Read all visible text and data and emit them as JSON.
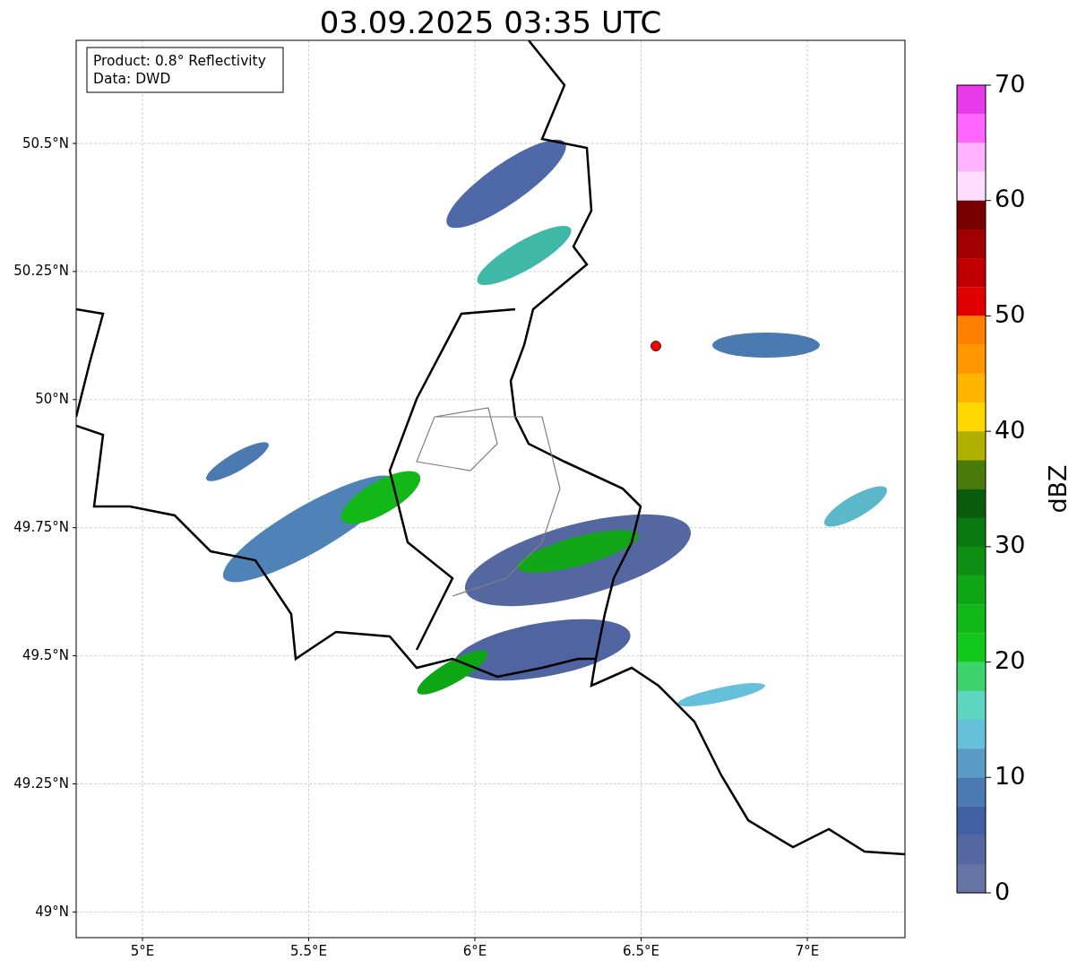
{
  "title": "03.09.2025 03:35 UTC",
  "info_box": [
    "Product: 0.8° Reflectivity",
    "Data: DWD"
  ],
  "map": {
    "y_ticks": [
      "50.5°N",
      "50.25°N",
      "50°N",
      "49.75°N",
      "49.5°N",
      "49.25°N",
      "49°N"
    ],
    "x_ticks": [
      "5°E",
      "5.5°E",
      "6°E",
      "6.5°E",
      "7°E"
    ]
  },
  "colorbar": {
    "label": "dBZ",
    "ticks": [
      "70",
      "60",
      "50",
      "40",
      "30",
      "20",
      "10",
      "0"
    ],
    "bands": [
      {
        "color": "#e83ae8"
      },
      {
        "color": "#ff66ff"
      },
      {
        "color": "#ffb2ff"
      },
      {
        "color": "#ffddff"
      },
      {
        "color": "#780000"
      },
      {
        "color": "#a00000"
      },
      {
        "color": "#c00000"
      },
      {
        "color": "#e00000"
      },
      {
        "color": "#ff7f00"
      },
      {
        "color": "#ff9800"
      },
      {
        "color": "#ffb400"
      },
      {
        "color": "#ffd800"
      },
      {
        "color": "#b0b000"
      },
      {
        "color": "#4a7a0a"
      },
      {
        "color": "#0a5c0c"
      },
      {
        "color": "#0a7a10"
      },
      {
        "color": "#0c8f12"
      },
      {
        "color": "#0ea614"
      },
      {
        "color": "#10b818"
      },
      {
        "color": "#12c81a"
      },
      {
        "color": "#3dd46e"
      },
      {
        "color": "#5ed6c2"
      },
      {
        "color": "#66c0dc"
      },
      {
        "color": "#5a9cc6"
      },
      {
        "color": "#4a7ab0"
      },
      {
        "color": "#425fa3"
      },
      {
        "color": "#5567a0"
      },
      {
        "color": "#6574a5"
      }
    ]
  }
}
